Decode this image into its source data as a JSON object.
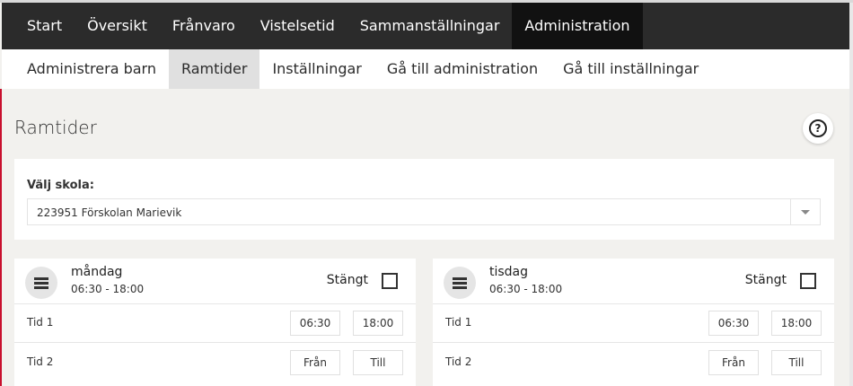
{
  "main_nav": [
    "Start",
    "Översikt",
    "Frånvaro",
    "Vistelsetid",
    "Sammanställningar",
    "Administration"
  ],
  "main_nav_active": "Administration",
  "sub_nav": [
    "Administrera barn",
    "Ramtider",
    "Inställningar",
    "Gå till administration",
    "Gå till inställningar"
  ],
  "sub_nav_active": "Ramtider",
  "page": {
    "title": "Ramtider",
    "help_icon": "question-circle-icon"
  },
  "school": {
    "label": "Välj skola:",
    "selected": "223951 Förskolan Marievik"
  },
  "days": [
    {
      "name": "måndag",
      "hours": "06:30 - 18:00",
      "closed_label": "Stängt",
      "closed": false,
      "tid1": {
        "label": "Tid 1",
        "from": "06:30",
        "to": "18:00"
      },
      "tid2": {
        "label": "Tid 2",
        "from_placeholder": "Från",
        "to_placeholder": "Till"
      }
    },
    {
      "name": "tisdag",
      "hours": "06:30 - 18:00",
      "closed_label": "Stängt",
      "closed": false,
      "tid1": {
        "label": "Tid 1",
        "from": "06:30",
        "to": "18:00"
      },
      "tid2": {
        "label": "Tid 2",
        "from_placeholder": "Från",
        "to_placeholder": "Till"
      }
    }
  ],
  "colors": {
    "nav_bg": "#2b2b2b",
    "nav_active_bg": "#111111",
    "accent": "#c8102e",
    "page_bg": "#f2f1ee"
  }
}
